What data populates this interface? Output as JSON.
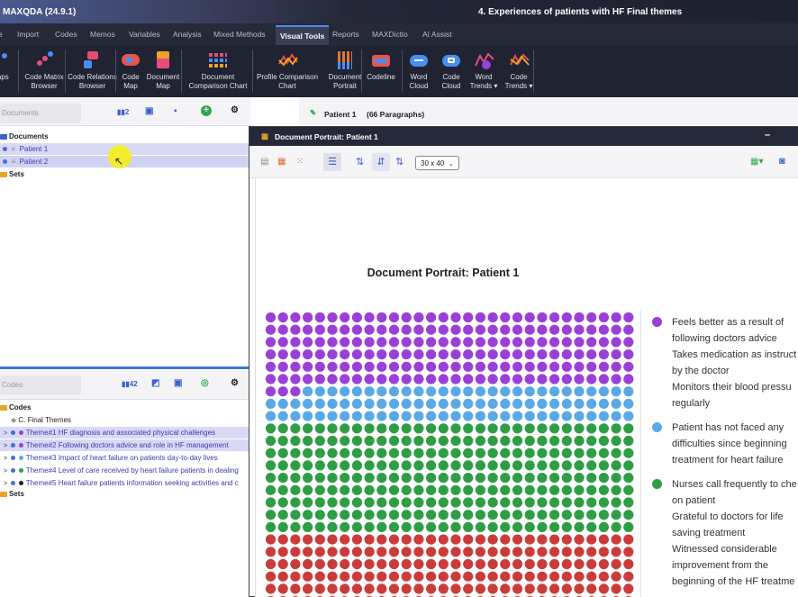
{
  "app": {
    "title": "MAXQDA (24.9.1)",
    "document_title": "4. Experiences of patients with HF Final themes"
  },
  "menu": [
    "e",
    "Import",
    "Codes",
    "Memos",
    "Variables",
    "Analysis",
    "Mixed Methods",
    "Visual Tools",
    "Reports",
    "MAXDictio",
    "AI Assist"
  ],
  "ribbon": [
    {
      "label": "Maps",
      "icon": "maps-icon"
    },
    {
      "label": "Code Matrix|Browser",
      "icon": "code-matrix-browser-icon"
    },
    {
      "label": "Code Relations|Browser",
      "icon": "code-relations-browser-icon"
    },
    {
      "label": "Code|Map",
      "icon": "code-map-icon"
    },
    {
      "label": "Document|Map",
      "icon": "document-map-icon"
    },
    {
      "label": "Document|Comparison Chart",
      "icon": "document-comparison-chart-icon"
    },
    {
      "label": "Profile Comparison|Chart",
      "icon": "profile-comparison-chart-icon"
    },
    {
      "label": "Document|Portrait",
      "icon": "document-portrait-icon"
    },
    {
      "label": "Codeline",
      "icon": "codeline-icon"
    },
    {
      "label": "Word|Cloud",
      "icon": "word-cloud-icon"
    },
    {
      "label": "Code|Cloud",
      "icon": "code-cloud-icon"
    },
    {
      "label": "Word|Trends ▾",
      "icon": "word-trends-icon"
    },
    {
      "label": "Code|Trends ▾",
      "icon": "code-trends-icon"
    }
  ],
  "documents_panel": {
    "search_placeholder": "Documents",
    "count": "2",
    "tree_root": "Documents",
    "items": [
      "Patient 1",
      "Patient 2"
    ],
    "sets": "Sets"
  },
  "codes_panel": {
    "search_placeholder": "Codes",
    "count": "42",
    "root": "Codes",
    "category": "C. Final Themes",
    "themes": [
      {
        "label": "Theme#1 HF diagnosis and associated physical challenges",
        "color": "#9b3fd9"
      },
      {
        "label": "Theme#2 Following doctors advice and role in HF management",
        "color": "#9b3fd9"
      },
      {
        "label": "Theme#3 Impact of heart failure on patients day-to-day lives",
        "color": "#5aa9e6"
      },
      {
        "label": "Theme#4 Level of care received  by heart failure patients in  dealing",
        "color": "#2e9e44"
      },
      {
        "label": "Theme#5 Heart failure patients information seeking activities and c",
        "color": "#222222"
      }
    ],
    "sets": "Sets"
  },
  "document_bar": {
    "label": "Patient 1",
    "paragraphs": "(66 Paragraphs)"
  },
  "portrait_window": {
    "title": "Document Portrait: Patient 1",
    "grid_size": "30 x 40",
    "heading": "Document Portrait: Patient 1"
  },
  "chart_data": {
    "type": "heatmap",
    "columns": 30,
    "rows_per_color": [
      {
        "color": "#9b3fd9",
        "rows": 6.1
      },
      {
        "color": "#5aa9e6",
        "rows": 2.9
      },
      {
        "color": "#2e9e44",
        "rows": 9
      },
      {
        "color": "#cc3b3b",
        "rows": 6
      }
    ]
  },
  "legend": [
    {
      "color": "#9b3fd9",
      "lines": [
        "Feels better as a result of",
        "following doctors advice",
        "Takes medication as instruct",
        "by the doctor",
        "Monitors their blood pressu",
        "regularly"
      ]
    },
    {
      "color": "#5aa9e6",
      "lines": [
        "Patient has not faced any",
        "difficulties since beginning",
        "treatment for heart failure"
      ]
    },
    {
      "color": "#2e9e44",
      "lines": [
        "Nurses call frequently to che",
        "on patient",
        "Grateful to doctors for life",
        "saving treatment",
        "Witnessed considerable",
        "improvement from the",
        "beginning of the HF treatme"
      ]
    }
  ]
}
